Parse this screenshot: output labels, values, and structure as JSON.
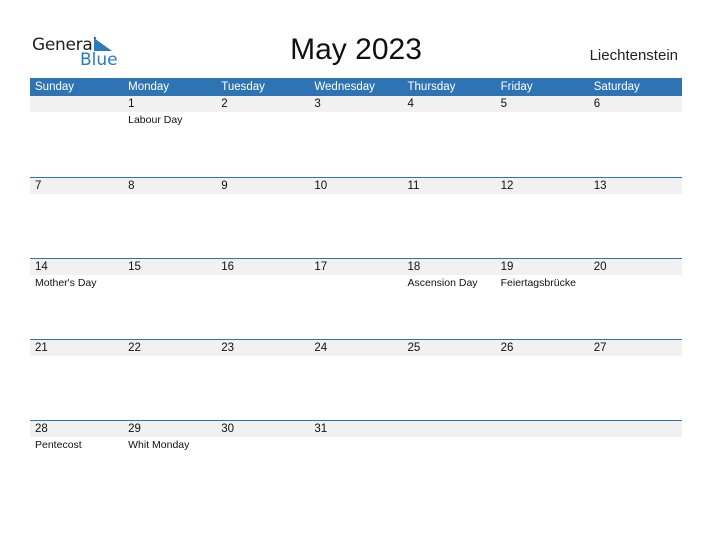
{
  "logo": {
    "line1": "General",
    "line2": "Blue"
  },
  "title": "May 2023",
  "country": "Liechtenstein",
  "colors": {
    "accent": "#2e74b5",
    "band": "#f1f1f1"
  },
  "weekdays": [
    "Sunday",
    "Monday",
    "Tuesday",
    "Wednesday",
    "Thursday",
    "Friday",
    "Saturday"
  ],
  "weeks": [
    {
      "days": [
        "",
        "1",
        "2",
        "3",
        "4",
        "5",
        "6"
      ],
      "holidays": [
        "",
        "Labour Day",
        "",
        "",
        "",
        "",
        ""
      ]
    },
    {
      "days": [
        "7",
        "8",
        "9",
        "10",
        "11",
        "12",
        "13"
      ],
      "holidays": [
        "",
        "",
        "",
        "",
        "",
        "",
        ""
      ]
    },
    {
      "days": [
        "14",
        "15",
        "16",
        "17",
        "18",
        "19",
        "20"
      ],
      "holidays": [
        "Mother's Day",
        "",
        "",
        "",
        "Ascension Day",
        "Feiertagsbrücke",
        ""
      ]
    },
    {
      "days": [
        "21",
        "22",
        "23",
        "24",
        "25",
        "26",
        "27"
      ],
      "holidays": [
        "",
        "",
        "",
        "",
        "",
        "",
        ""
      ]
    },
    {
      "days": [
        "28",
        "29",
        "30",
        "31",
        "",
        "",
        ""
      ],
      "holidays": [
        "Pentecost",
        "Whit Monday",
        "",
        "",
        "",
        "",
        ""
      ]
    }
  ]
}
